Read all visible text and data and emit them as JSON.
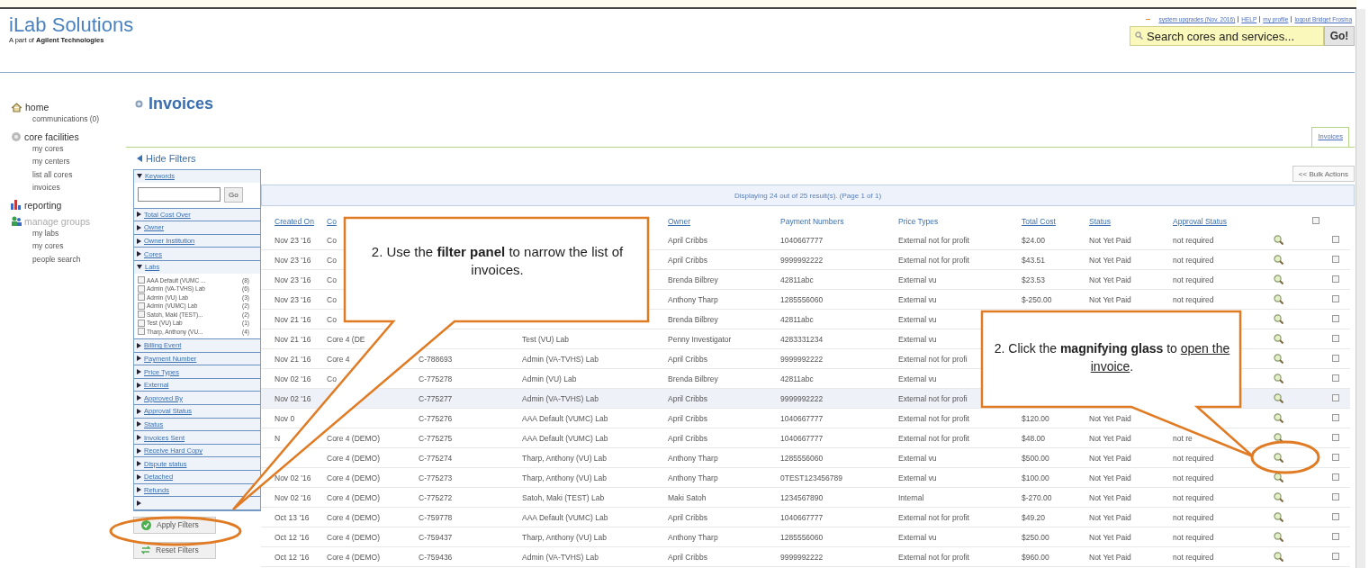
{
  "brand": {
    "name": "iLab Solutions",
    "tagline": "A part of **Agilent Technologies**"
  },
  "top_links": [
    "system upgrades (Nov. 2016)",
    "HELP",
    "my profile",
    "logout Bridget Frosina"
  ],
  "search": {
    "placeholder": "Search cores and services...",
    "button": "Go!"
  },
  "nav": [
    {
      "label": "home",
      "disabled": false,
      "children": [
        "communications (0)"
      ]
    },
    {
      "label": "core facilities",
      "disabled": false,
      "children": [
        "my cores",
        "my centers",
        "list all cores",
        "invoices"
      ]
    },
    {
      "label": "reporting",
      "disabled": false
    },
    {
      "label": "manage groups",
      "disabled": true,
      "children": [
        "my labs",
        "my cores",
        "people search"
      ]
    }
  ],
  "page_title": "Invoices",
  "tabs": [
    {
      "label": "Invoices",
      "selected": true
    }
  ],
  "hide_filters": "Hide Filters",
  "filters": [
    {
      "label": "Keywords",
      "kind": "search",
      "expanded": true,
      "button": "Go"
    },
    {
      "label": "Total Cost Over",
      "kind": "plain",
      "expanded": false
    },
    {
      "label": "Owner",
      "kind": "plain",
      "expanded": false
    },
    {
      "label": "Owner Institution",
      "kind": "plain",
      "expanded": false
    },
    {
      "label": "Cores",
      "kind": "plain",
      "expanded": false
    },
    {
      "label": "Labs",
      "kind": "list",
      "expanded": true,
      "options": [
        {
          "label": "AAA Default (VUMC ...",
          "count": "(8)",
          "checked": false
        },
        {
          "label": "Admin (VA-TVHS) Lab",
          "count": "(6)",
          "checked": false
        },
        {
          "label": "Admin (VU) Lab",
          "count": "(3)",
          "checked": false
        },
        {
          "label": "Admin (VUMC) Lab",
          "count": "(2)",
          "checked": false
        },
        {
          "label": "Satoh, Maki (TEST)...",
          "count": "(2)",
          "checked": false
        },
        {
          "label": "Test (VU) Lab",
          "count": "(1)",
          "checked": false
        },
        {
          "label": "Tharp, Anthony (VU...",
          "count": "(4)",
          "checked": false
        }
      ]
    },
    {
      "label": "Billing Event",
      "kind": "plain",
      "expanded": false
    },
    {
      "label": "Payment Number",
      "kind": "plain",
      "expanded": false
    },
    {
      "label": "Price Types",
      "kind": "plain",
      "expanded": false
    },
    {
      "label": "External",
      "kind": "plain",
      "expanded": false
    },
    {
      "label": "Approved By",
      "kind": "plain",
      "expanded": false
    },
    {
      "label": "Approval Status",
      "kind": "plain",
      "expanded": false
    },
    {
      "label": "Status",
      "kind": "plain",
      "expanded": false
    },
    {
      "label": "Invoices Sent",
      "kind": "plain",
      "expanded": false
    },
    {
      "label": "Receive Hard Copy",
      "kind": "plain",
      "expanded": false
    },
    {
      "label": "Dispute status",
      "kind": "plain",
      "expanded": false
    },
    {
      "label": "Detached",
      "kind": "plain",
      "expanded": false
    },
    {
      "label": "Refunds",
      "kind": "plain",
      "expanded": false
    },
    {
      "kind": "plain",
      "expanded": false
    }
  ],
  "filter_buttons": [
    "Apply Filters",
    "Reset Filters"
  ],
  "bulk_actions": "<< Bulk Actions",
  "results_info": "Displaying 24 out of 25 result(s). (Page 1 of 1)",
  "table": {
    "columns": [
      {
        "label": "Created On",
        "sortable": true
      },
      {
        "label": "Co",
        "sortable": true
      },
      null,
      null,
      {
        "label": "Owner",
        "sortable": true
      },
      {
        "label": "Payment Numbers",
        "sortable": false
      },
      {
        "label": "Price Types",
        "sortable": false
      },
      {
        "label": "Total Cost",
        "sortable": true
      },
      {
        "label": "Status",
        "sortable": true
      },
      {
        "label": "Approval Status",
        "sortable": true
      }
    ],
    "header_checked": false,
    "rows": [
      {
        "cells": [
          "Nov 23 '16",
          "Co",
          null,
          null,
          "April Cribbs",
          "1040667777",
          "External not for profit",
          "$24.00",
          "Not Yet Paid",
          "not required"
        ],
        "highlighted": false,
        "checked": false
      },
      {
        "cells": [
          "Nov 23 '16",
          "Co",
          null,
          null,
          "April Cribbs",
          "9999992222",
          "External not for profit",
          "$43.51",
          "Not Yet Paid",
          "not required"
        ],
        "highlighted": false,
        "checked": false
      },
      {
        "cells": [
          "Nov 23 '16",
          "Co",
          null,
          null,
          "Brenda Bilbrey",
          "42811abc",
          "External vu",
          "$23.53",
          "Not Yet Paid",
          "not required"
        ],
        "highlighted": false,
        "checked": false
      },
      {
        "cells": [
          "Nov 23 '16",
          "Co",
          null,
          null,
          "Anthony Tharp",
          "1285556060",
          "External vu",
          "$-250.00",
          "Not Yet Paid",
          "not required"
        ],
        "highlighted": false,
        "checked": false
      },
      {
        "cells": [
          "Nov 21 '16",
          "Co",
          null,
          null,
          "Brenda Bilbrey",
          "42811abc",
          "External vu",
          null,
          null,
          null
        ],
        "highlighted": false,
        "checked": false
      },
      {
        "cells": [
          "Nov 21 '16",
          "Core 4 (DE",
          null,
          "Test (VU) Lab",
          "Penny Investigator",
          "4283331234",
          "External vu",
          null,
          null,
          null
        ],
        "highlighted": false,
        "checked": false
      },
      {
        "cells": [
          "Nov 21 '16",
          "Core 4",
          "C-788693",
          "Admin (VA-TVHS) Lab",
          "April Cribbs",
          "9999992222",
          "External not for profi",
          null,
          null,
          null
        ],
        "highlighted": false,
        "checked": false
      },
      {
        "cells": [
          "Nov 02 '16",
          "Co",
          "C-775278",
          "Admin (VU) Lab",
          "Brenda Bilbrey",
          "42811abc",
          "External vu",
          null,
          null,
          null
        ],
        "highlighted": false,
        "checked": false
      },
      {
        "cells": [
          "Nov 02 '16",
          null,
          "C-775277",
          "Admin (VA-TVHS) Lab",
          "April Cribbs",
          "9999992222",
          "External not for profi",
          null,
          null,
          null
        ],
        "highlighted": true,
        "checked": false
      },
      {
        "cells": [
          "Nov 0",
          null,
          "C-775276",
          "AAA Default (VUMC) Lab",
          "April Cribbs",
          "1040667777",
          "External not for profit",
          "$120.00",
          "Not Yet Paid",
          null
        ],
        "highlighted": false,
        "checked": false
      },
      {
        "cells": [
          "N",
          "Core 4 (DEMO)",
          "C-775275",
          "AAA Default (VUMC) Lab",
          "April Cribbs",
          "1040667777",
          "External not for profit",
          "$48.00",
          "Not Yet Paid",
          "not re"
        ],
        "highlighted": false,
        "checked": false
      },
      {
        "cells": [
          null,
          "Core 4 (DEMO)",
          "C-775274",
          "Tharp, Anthony (VU) Lab",
          "Anthony Tharp",
          "1285556060",
          "External vu",
          "$500.00",
          "Not Yet Paid",
          "not required"
        ],
        "highlighted": false,
        "checked": false
      },
      {
        "cells": [
          "Nov 02 '16",
          "Core 4 (DEMO)",
          "C-775273",
          "Tharp, Anthony (VU) Lab",
          "Anthony Tharp",
          "0TEST123456789",
          "External vu",
          "$100.00",
          "Not Yet Paid",
          "not required"
        ],
        "highlighted": false,
        "checked": false
      },
      {
        "cells": [
          "Nov 02 '16",
          "Core 4 (DEMO)",
          "C-775272",
          "Satoh, Maki (TEST) Lab",
          "Maki Satoh",
          "1234567890",
          "Internal",
          "$-270.00",
          "Not Yet Paid",
          "not required"
        ],
        "highlighted": false,
        "checked": false
      },
      {
        "cells": [
          "Oct 13 '16",
          "Core 4 (DEMO)",
          "C-759778",
          "AAA Default (VUMC) Lab",
          "April Cribbs",
          "1040667777",
          "External not for profit",
          "$49.20",
          "Not Yet Paid",
          "not required"
        ],
        "highlighted": false,
        "checked": false
      },
      {
        "cells": [
          "Oct 12 '16",
          "Core 4 (DEMO)",
          "C-759437",
          "Tharp, Anthony (VU) Lab",
          "Anthony Tharp",
          "1285556060",
          "External vu",
          "$250.00",
          "Not Yet Paid",
          "not required"
        ],
        "highlighted": false,
        "checked": false
      },
      {
        "cells": [
          "Oct 12 '16",
          "Core 4 (DEMO)",
          "C-759436",
          "Admin (VA-TVHS) Lab",
          "April Cribbs",
          "9999992222",
          "External not for profit",
          "$960.00",
          "Not Yet Paid",
          "not required"
        ],
        "highlighted": false,
        "checked": false
      }
    ]
  },
  "callouts": [
    {
      "text": "2. Use the **filter panel** to narrow the list of invoices."
    },
    {
      "text": "2. Click the **magnifying glass** to ",
      "underlined": "open the invoice",
      "after": "."
    }
  ]
}
